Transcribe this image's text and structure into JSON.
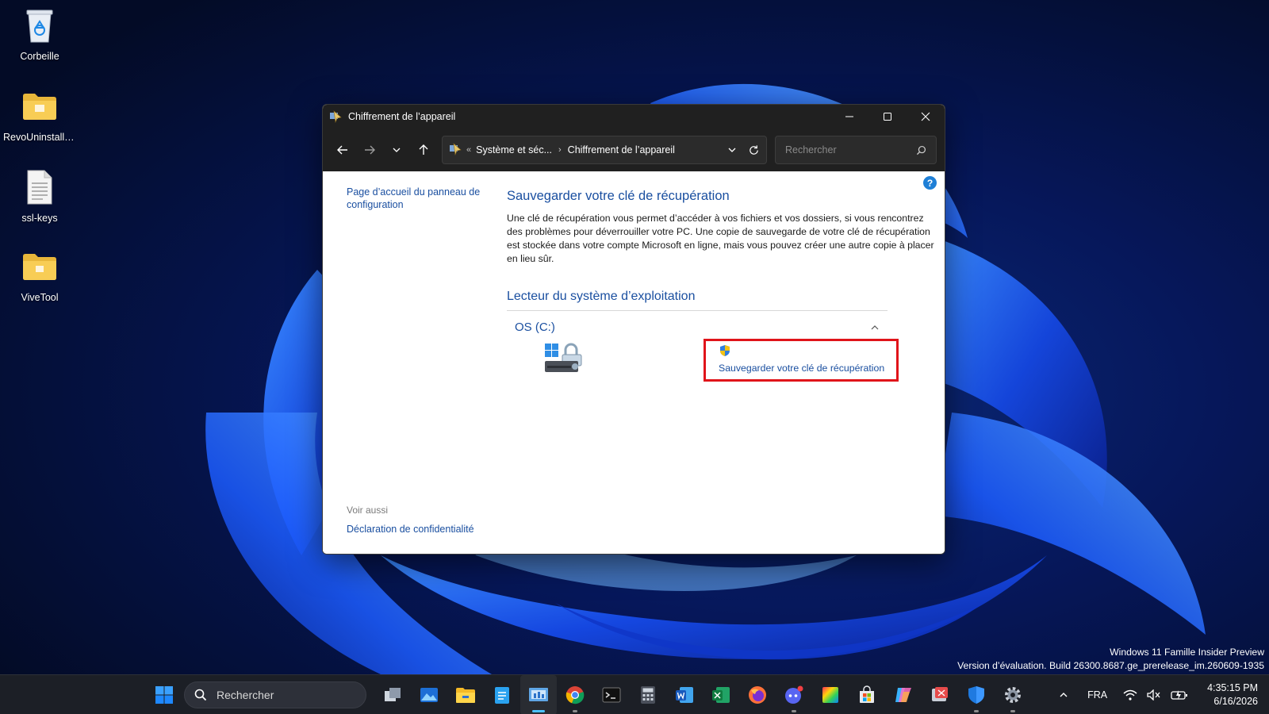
{
  "desktop": {
    "icons": [
      {
        "label": "Corbeille"
      },
      {
        "label": "RevoUninstalle..."
      },
      {
        "label": "ssl-keys"
      },
      {
        "label": "ViveTool"
      }
    ]
  },
  "window": {
    "title": "Chiffrement de l’appareil",
    "address": {
      "overflow": "«",
      "crumbs": [
        "Système et séc...",
        "Chiffrement de l’appareil"
      ]
    },
    "search_placeholder": "Rechercher",
    "left": {
      "home_link": "Page d’accueil du panneau de configuration",
      "see_also_title": "Voir aussi",
      "privacy_link": "Déclaration de confidentialité"
    },
    "main": {
      "heading": "Sauvegarder votre clé de récupération",
      "description": "Une clé de récupération vous permet d’accéder à vos fichiers et vos dossiers, si vous rencontrez des problèmes pour déverrouiller votre PC. Une copie de sauvegarde de votre clé de récupération est stockée dans votre compte Microsoft en ligne, mais vous pouvez créer une autre copie à placer en lieu sûr.",
      "section_heading": "Lecteur du système d’exploitation",
      "drive_name": "OS (C:)",
      "backup_link": "Sauvegarder votre clé de récupération"
    },
    "help_glyph": "?"
  },
  "watermark": {
    "line1": "Windows 11 Famille Insider Preview",
    "line2": "Version d’évaluation. Build 26300.8687.ge_prerelease_im.260609-1935"
  },
  "taskbar": {
    "search_label": "Rechercher",
    "language": "FRA",
    "time": "4:35:15 PM",
    "date": "6/16/2026"
  },
  "colors": {
    "link": "#1a4fa0",
    "highlight_border": "#e0141a",
    "accent": "#4cc2ff"
  }
}
